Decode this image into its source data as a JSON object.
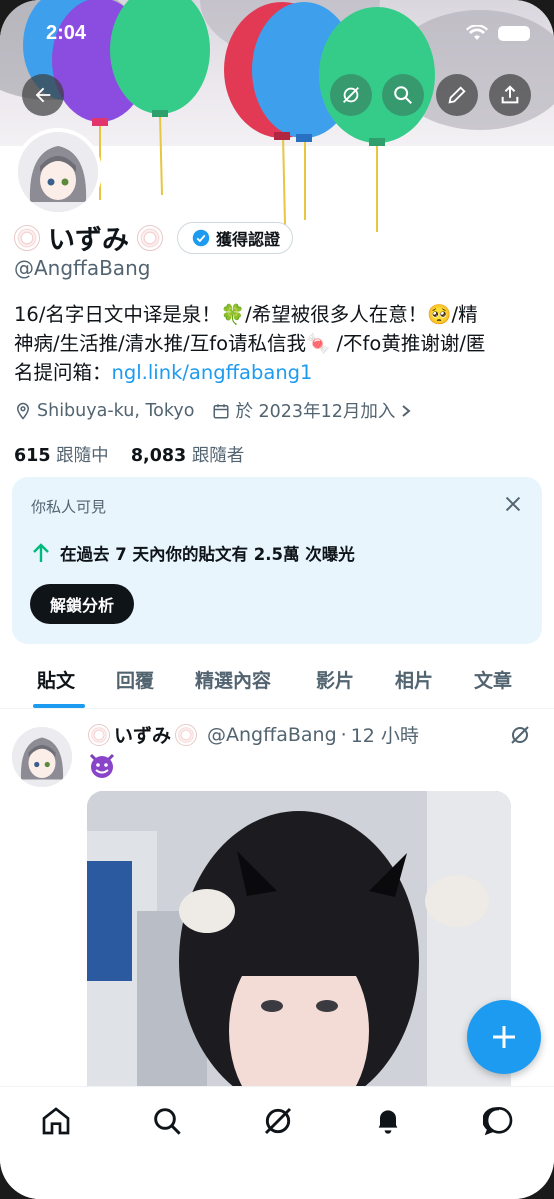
{
  "status_bar": {
    "time": "2:04"
  },
  "profile": {
    "display_name": "いずみ",
    "verified_label": "獲得認證",
    "handle": "@AngffaBang",
    "bio_line1": "16/名字日文中译是泉！🍀/希望被很多人在意！🥺/精",
    "bio_line2": "神病/生活推/清水推/互fo请私信我🍬 /不fo黄推谢谢/匿",
    "bio_line3_prefix": "名提问箱：",
    "bio_link": "ngl.link/angffabang1",
    "location": "Shibuya-ku, Tokyo",
    "joined": "於 2023年12月加入",
    "following_count": "615",
    "following_label": "跟隨中",
    "followers_count": "8,083",
    "followers_label": "跟隨者"
  },
  "insight_card": {
    "label": "你私人可見",
    "message": "在過去 7 天內你的貼文有 2.5萬 次曝光",
    "button": "解鎖分析"
  },
  "tabs": [
    "貼文",
    "回覆",
    "精選內容",
    "影片",
    "相片",
    "文章"
  ],
  "post": {
    "name": "いずみ",
    "handle": "@AngffaBang",
    "dot": "·",
    "time": "12 小時"
  },
  "icons": {
    "back": "back-arrow-icon",
    "grok": "grok-icon",
    "search": "search-icon",
    "edit": "edit-icon",
    "share": "share-icon",
    "compose": "plus-icon",
    "nav": [
      "home-icon",
      "search-icon",
      "grok-icon",
      "bell-icon",
      "message-icon"
    ]
  },
  "colors": {
    "accent": "#1d9bf0",
    "text": "#0f1419",
    "muted": "#536471",
    "card_bg": "#e8f5fd"
  }
}
